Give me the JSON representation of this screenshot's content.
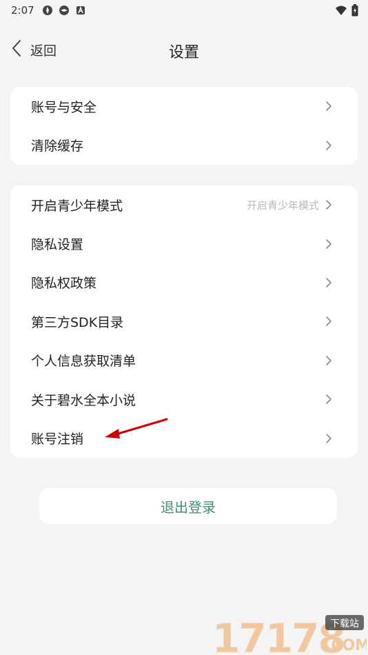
{
  "status": {
    "time": "2:07",
    "icons": [
      "app-icon",
      "app-icon",
      "notification-icon"
    ],
    "right_icons": [
      "wifi-icon",
      "battery-icon"
    ]
  },
  "appbar": {
    "back_label": "返回",
    "title": "设置"
  },
  "group1": [
    {
      "label": "账号与安全"
    },
    {
      "label": "清除缓存"
    }
  ],
  "group2": [
    {
      "label": "开启青少年模式",
      "value": "开启青少年模式"
    },
    {
      "label": "隐私设置"
    },
    {
      "label": "隐私权政策"
    },
    {
      "label": "第三方SDK目录"
    },
    {
      "label": "个人信息获取清单"
    },
    {
      "label": "关于碧水全本小说"
    },
    {
      "label": "账号注销"
    }
  ],
  "logout_label": "退出登录",
  "watermark": {
    "number": "17178",
    "badge": "下载站",
    "domain": ".COM"
  },
  "colors": {
    "background": "#f4f4f4",
    "card": "#ffffff",
    "logout_text": "#3f8e7c",
    "annotation_arrow": "#d40000"
  }
}
